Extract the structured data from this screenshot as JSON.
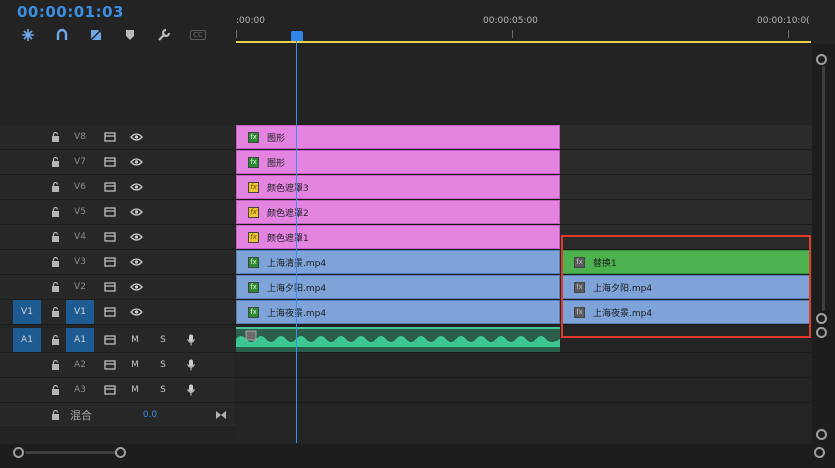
{
  "header": {
    "timecode": "00:00:01:03",
    "tools": [
      {
        "icon": "snap-magnet-icon"
      },
      {
        "icon": "linked-selection-icon"
      },
      {
        "icon": "add-marker-icon"
      },
      {
        "icon": "marker-icon"
      },
      {
        "icon": "wrench-icon"
      },
      {
        "icon": "captions-icon",
        "label": "CC"
      }
    ]
  },
  "ruler": {
    "labels": [
      ":00:00",
      "00:00:05:00",
      "00:00:10:0("
    ]
  },
  "video_tracks": [
    {
      "name": "V8",
      "lock_icon": "lock-icon",
      "sync_icon": "film-icon",
      "eye_icon": "eye-icon"
    },
    {
      "name": "V7",
      "lock_icon": "lock-icon",
      "sync_icon": "film-icon",
      "eye_icon": "eye-icon"
    },
    {
      "name": "V6",
      "lock_icon": "lock-icon",
      "sync_icon": "film-icon",
      "eye_icon": "eye-icon"
    },
    {
      "name": "V5",
      "lock_icon": "lock-icon",
      "sync_icon": "film-icon",
      "eye_icon": "eye-icon"
    },
    {
      "name": "V4",
      "lock_icon": "lock-icon",
      "sync_icon": "film-icon",
      "eye_icon": "eye-icon"
    },
    {
      "name": "V3",
      "lock_icon": "lock-icon",
      "sync_icon": "film-icon",
      "eye_icon": "eye-icon"
    },
    {
      "name": "V2",
      "lock_icon": "lock-icon",
      "sync_icon": "film-icon",
      "eye_icon": "eye-icon"
    },
    {
      "name": "V1",
      "source_patch": "V1",
      "lock_icon": "lock-icon",
      "sync_icon": "film-icon",
      "eye_icon": "eye-icon"
    }
  ],
  "audio_tracks": [
    {
      "name": "A1",
      "source_patch": "A1",
      "m": "M",
      "s": "S"
    },
    {
      "name": "A2",
      "m": "M",
      "s": "S"
    },
    {
      "name": "A3",
      "m": "M",
      "s": "S"
    }
  ],
  "mix": {
    "label": "混合",
    "value": "0.0"
  },
  "clips": {
    "v8": {
      "label": "图形",
      "badge": "fx"
    },
    "v7": {
      "label": "图形",
      "badge": "fx"
    },
    "v6": {
      "label": "颜色遮罩3",
      "badge": "fx"
    },
    "v5": {
      "label": "颜色遮罩2",
      "badge": "fx"
    },
    "v4": {
      "label": "颜色遮罩1",
      "badge": "fx"
    },
    "v3a": {
      "label": "上海清景.mp4",
      "badge": "fx"
    },
    "v2a": {
      "label": "上海夕阳.mp4",
      "badge": "fx"
    },
    "v1a": {
      "label": "上海夜景.mp4",
      "badge": "fx"
    },
    "v3b": {
      "label": "替换1",
      "badge": "fx"
    },
    "v2b": {
      "label": "上海夕阳.mp4",
      "badge": "fx"
    },
    "v1b": {
      "label": "上海夜景.mp4",
      "badge": "fx"
    }
  },
  "colors": {
    "timecode": "#3c8fe0",
    "playhead": "#3b8ff0",
    "graphics_clip": "#e384e1",
    "video_clip": "#7da3d9",
    "adjustment_clip": "#4cb24f",
    "audio_clip": "#2b5f4c",
    "highlight": "#e03a2a"
  }
}
